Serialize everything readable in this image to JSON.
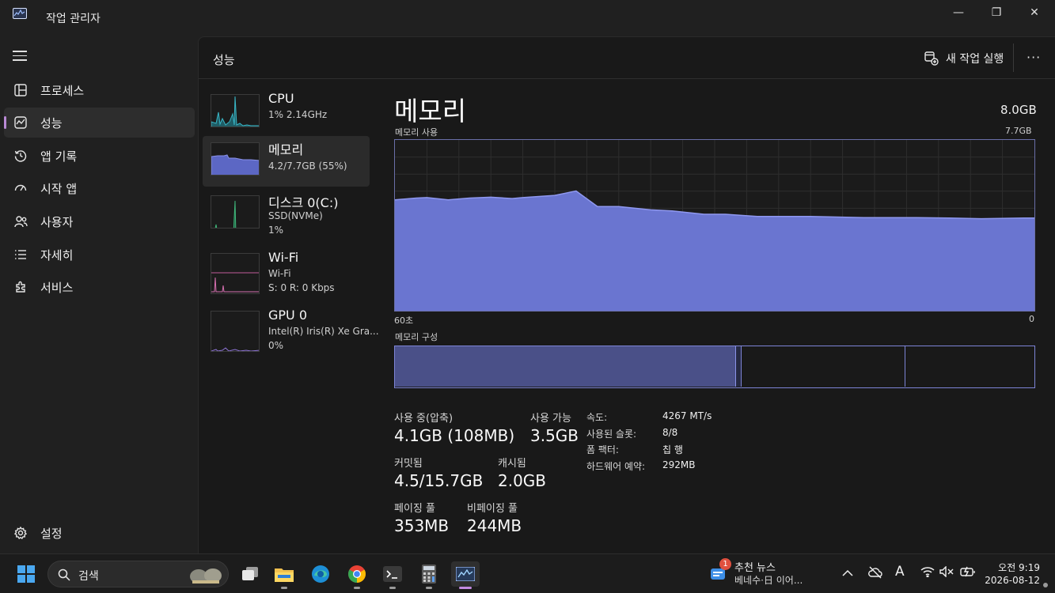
{
  "window": {
    "title": "작업 관리자",
    "minimize": "—",
    "maximize": "❐",
    "close": "✕"
  },
  "nav": {
    "items": [
      {
        "label": "프로세스",
        "icon": "processes-grid-icon"
      },
      {
        "label": "성능",
        "icon": "performance-chart-icon",
        "active": true
      },
      {
        "label": "앱 기록",
        "icon": "history-clock-icon"
      },
      {
        "label": "시작 앱",
        "icon": "startup-gauge-icon"
      },
      {
        "label": "사용자",
        "icon": "users-icon"
      },
      {
        "label": "자세히",
        "icon": "details-list-icon"
      },
      {
        "label": "서비스",
        "icon": "services-puzzle-icon"
      }
    ],
    "settings_label": "설정"
  },
  "cmdbar": {
    "page_title": "성능",
    "run_new_task": "새 작업 실행",
    "more": "···"
  },
  "devices": [
    {
      "name": "CPU",
      "line1": "1% 2.14GHz",
      "line2": ""
    },
    {
      "name": "메모리",
      "line1": "4.2/7.7GB (55%)",
      "line2": "",
      "selected": true
    },
    {
      "name": "디스크 0(C:)",
      "line1": "SSD(NVMe)",
      "line2": "1%"
    },
    {
      "name": "Wi-Fi",
      "line1": "Wi-Fi",
      "line2": "S: 0 R: 0 Kbps"
    },
    {
      "name": "GPU 0",
      "line1": "Intel(R) Iris(R) Xe Gra...",
      "line2": "0%"
    }
  ],
  "detail": {
    "title": "메모리",
    "total": "8.0GB",
    "usage_label": "메모리 사용",
    "usage_max": "7.7GB",
    "axis_left": "60초",
    "axis_right": "0",
    "composition_label": "메모리 구성",
    "composition": {
      "in_use_fraction": 0.534,
      "modified_fraction": 0.009,
      "standby_fraction": 0.256
    },
    "stats": {
      "in_use_label": "사용 중(압축)",
      "in_use_value": "4.1GB (108MB)",
      "available_label": "사용 가능",
      "available_value": "3.5GB",
      "committed_label": "커밋됨",
      "committed_value": "4.5/15.7GB",
      "cached_label": "캐시됨",
      "cached_value": "2.0GB",
      "paged_label": "페이징 풀",
      "paged_value": "353MB",
      "nonpaged_label": "비페이징 풀",
      "nonpaged_value": "244MB"
    },
    "props": [
      {
        "key": "속도:",
        "value": "4267 MT/s"
      },
      {
        "key": "사용된 슬롯:",
        "value": "8/8"
      },
      {
        "key": "폼 팩터:",
        "value": "칩 행"
      },
      {
        "key": "하드웨어 예약:",
        "value": "292MB"
      }
    ]
  },
  "chart_data": {
    "type": "area",
    "title": "메모리 사용",
    "ylim": [
      0,
      7.7
    ],
    "xlabel_left": "60초",
    "xlabel_right": "0",
    "grid": true,
    "color": "#6a75d0",
    "x": [
      60,
      58,
      57,
      55,
      53,
      51,
      49,
      48,
      45,
      43,
      41,
      40,
      39,
      36,
      34,
      31,
      29,
      26,
      25,
      21,
      16,
      11,
      8,
      5,
      1,
      0
    ],
    "values": [
      5.0,
      5.08,
      5.1,
      5.0,
      5.08,
      5.12,
      5.06,
      5.1,
      5.2,
      5.4,
      4.7,
      4.7,
      4.7,
      4.55,
      4.5,
      4.35,
      4.35,
      4.25,
      4.25,
      4.25,
      4.2,
      4.2,
      4.18,
      4.15,
      4.18,
      4.18
    ]
  },
  "taskbar": {
    "search_placeholder": "검색",
    "news_badge": "1",
    "news_title": "추천 뉴스",
    "news_sub": "베네수·日 이어...",
    "tray_chevron": "^",
    "ime": "A",
    "time": "오전 9:19",
    "date": "2026-08-12"
  }
}
